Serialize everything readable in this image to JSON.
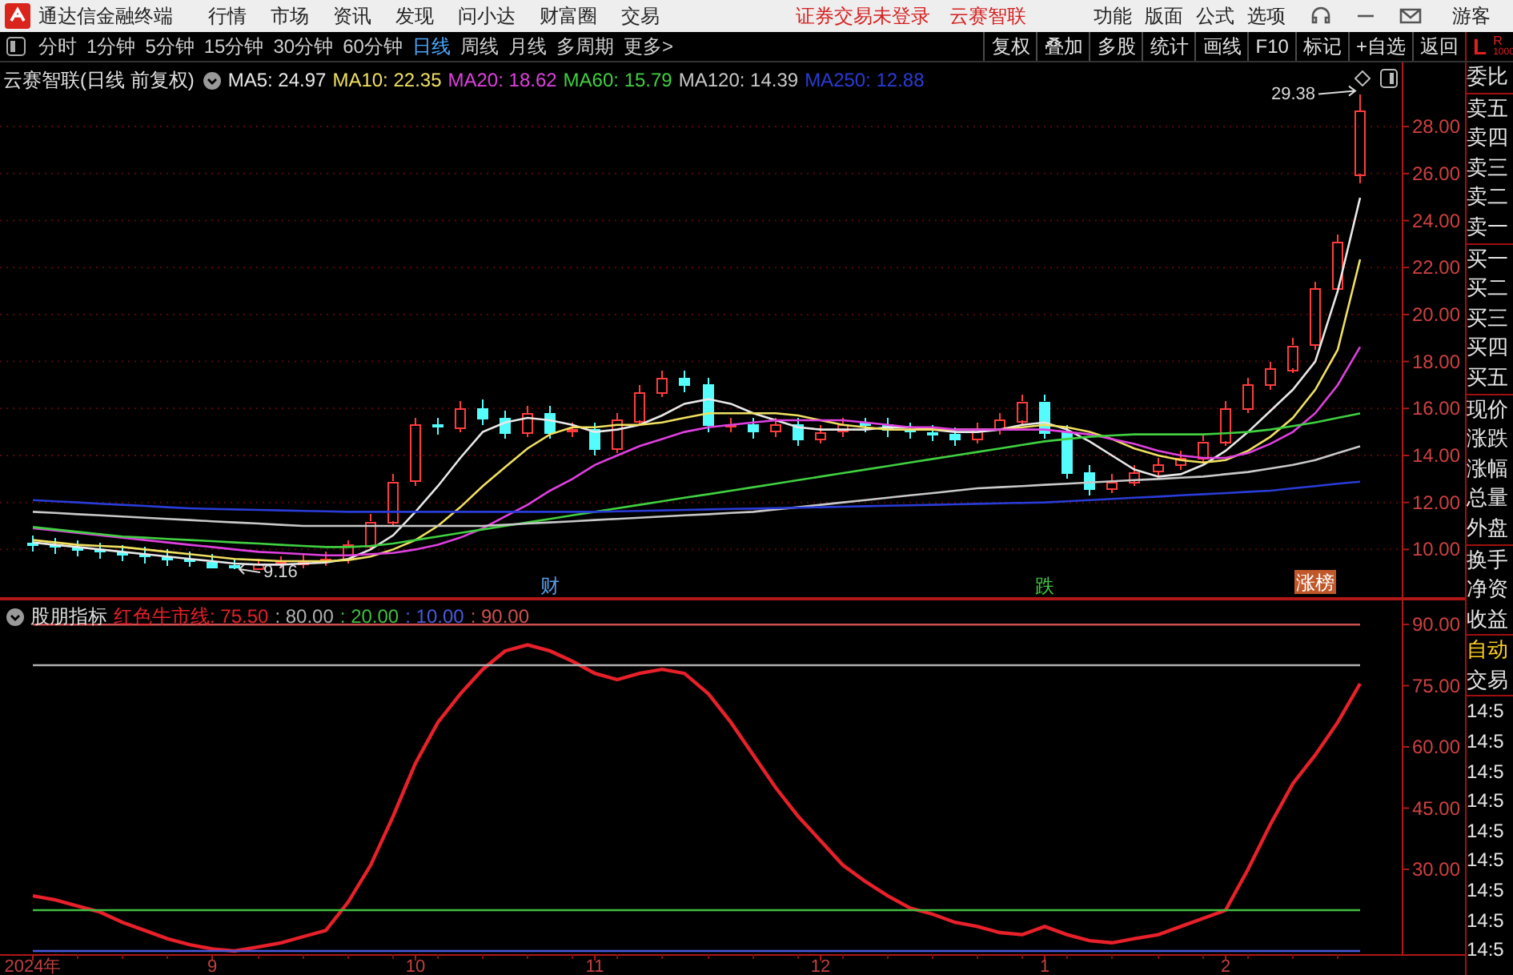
{
  "title_bar": {
    "app_name": "通达信金融终端",
    "menu": [
      "行情",
      "市场",
      "资讯",
      "发现",
      "问小达",
      "财富圈",
      "交易"
    ],
    "notices": [
      "证券交易未登录",
      "云赛智联"
    ],
    "tools": [
      "功能",
      "版面",
      "公式",
      "选项"
    ],
    "user": "游客"
  },
  "period_tabs": [
    {
      "label": "分时",
      "selected": false
    },
    {
      "label": "1分钟",
      "selected": false
    },
    {
      "label": "5分钟",
      "selected": false
    },
    {
      "label": "15分钟",
      "selected": false
    },
    {
      "label": "30分钟",
      "selected": false
    },
    {
      "label": "60分钟",
      "selected": false
    },
    {
      "label": "日线",
      "selected": true
    },
    {
      "label": "周线",
      "selected": false
    },
    {
      "label": "月线",
      "selected": false
    },
    {
      "label": "多周期",
      "selected": false
    },
    {
      "label": "更多>",
      "selected": false
    }
  ],
  "toolbar_buttons": [
    "复权",
    "叠加",
    "多股",
    "统计",
    "画线",
    "F10",
    "标记",
    "+自选",
    "返回"
  ],
  "corner": {
    "left": "L",
    "right": "R",
    "sub": "1000"
  },
  "price_panel": {
    "title": "云赛智联(日线 前复权)",
    "legend_values": [
      ": 24.97",
      ": 22.35",
      ": 18.62",
      ": 15.79",
      ": 14.39",
      ": 12.88"
    ],
    "candle_styles": [
      {
        "kind": "rising",
        "color": "#ff3c3c"
      },
      {
        "kind": "falling",
        "color": "#54fcfc"
      }
    ],
    "event_styles": [
      {
        "kind": "text",
        "color": "#5a9ee8"
      },
      {
        "kind": "text",
        "color": "#40c840"
      },
      {
        "kind": "tag",
        "color": "#c0582a"
      }
    ],
    "chart_data": {
      "type": "candlestick",
      "grid": true,
      "ylim": [
        7.9,
        30.73
      ],
      "categories": [
        null,
        null,
        null,
        null,
        null,
        null,
        null,
        null,
        null,
        null,
        null,
        null,
        null,
        null,
        null,
        null,
        null,
        null,
        null,
        null,
        null,
        null,
        null,
        "财",
        null,
        null,
        null,
        null,
        null,
        null,
        null,
        null,
        null,
        null,
        null,
        null,
        null,
        null,
        null,
        null,
        null,
        null,
        null,
        null,
        null,
        "跌",
        null,
        null,
        null,
        null,
        null,
        null,
        null,
        null,
        null,
        null,
        null,
        "涨榜",
        null,
        null
      ],
      "yticks": [
        {
          "value": 10,
          "label": "10.00"
        },
        {
          "value": 12,
          "label": "12.00"
        },
        {
          "value": 14,
          "label": "14.00"
        },
        {
          "value": 16,
          "label": "16.00"
        },
        {
          "value": 18,
          "label": "18.00"
        },
        {
          "value": 20,
          "label": "20.00"
        },
        {
          "value": 22,
          "label": "22.00"
        },
        {
          "value": 24,
          "label": "24.00"
        },
        {
          "value": 26,
          "label": "26.00"
        },
        {
          "value": 28,
          "label": "28.00"
        }
      ],
      "ohlc": [
        [
          10.3,
          10.6,
          9.9,
          10.2
        ],
        [
          10.2,
          10.5,
          9.8,
          10.1
        ],
        [
          10.1,
          10.4,
          9.7,
          10.0
        ],
        [
          10.0,
          10.3,
          9.6,
          9.9
        ],
        [
          9.9,
          10.2,
          9.5,
          9.8
        ],
        [
          9.8,
          10.1,
          9.4,
          9.7
        ],
        [
          9.7,
          10.0,
          9.3,
          9.6
        ],
        [
          9.6,
          9.9,
          9.25,
          9.5
        ],
        [
          9.5,
          9.8,
          9.2,
          9.3
        ],
        [
          9.3,
          9.6,
          9.16,
          9.2
        ],
        [
          9.2,
          9.6,
          9.17,
          9.4
        ],
        [
          9.4,
          9.7,
          9.2,
          9.45
        ],
        [
          9.45,
          9.8,
          9.2,
          9.5
        ],
        [
          9.5,
          9.9,
          9.3,
          9.6
        ],
        [
          9.6,
          10.4,
          9.4,
          10.2
        ],
        [
          10.2,
          11.5,
          10.0,
          11.2
        ],
        [
          11.2,
          13.2,
          11.0,
          12.9
        ],
        [
          12.9,
          15.6,
          12.7,
          15.3
        ],
        [
          15.3,
          15.6,
          14.9,
          15.2
        ],
        [
          15.2,
          16.3,
          15.0,
          16.0
        ],
        [
          16.0,
          16.4,
          15.3,
          15.6
        ],
        [
          15.6,
          15.9,
          14.7,
          15.0
        ],
        [
          15.0,
          16.1,
          14.8,
          15.8
        ],
        [
          15.8,
          16.1,
          14.7,
          15.0
        ],
        [
          15.0,
          15.4,
          14.8,
          15.1
        ],
        [
          15.1,
          15.4,
          14.0,
          14.3
        ],
        [
          14.3,
          15.8,
          14.1,
          15.5
        ],
        [
          15.5,
          17.0,
          15.3,
          16.7
        ],
        [
          16.7,
          17.6,
          16.5,
          17.3
        ],
        [
          17.3,
          17.6,
          16.7,
          17.0
        ],
        [
          17.0,
          17.3,
          15.0,
          15.3
        ],
        [
          15.2,
          15.6,
          15.0,
          15.3
        ],
        [
          15.3,
          15.6,
          14.7,
          15.0
        ],
        [
          15.0,
          15.6,
          14.8,
          15.3
        ],
        [
          15.3,
          15.6,
          14.4,
          14.7
        ],
        [
          14.7,
          15.3,
          14.5,
          15.0
        ],
        [
          15.0,
          15.6,
          14.8,
          15.3
        ],
        [
          15.4,
          15.6,
          15.0,
          15.3
        ],
        [
          15.3,
          15.6,
          14.8,
          15.1
        ],
        [
          15.1,
          15.4,
          14.7,
          15.0
        ],
        [
          15.0,
          15.3,
          14.6,
          14.9
        ],
        [
          14.9,
          15.2,
          14.4,
          14.7
        ],
        [
          14.7,
          15.4,
          14.5,
          15.1
        ],
        [
          15.1,
          15.8,
          14.9,
          15.5
        ],
        [
          15.5,
          16.6,
          15.3,
          16.3
        ],
        [
          16.3,
          16.6,
          14.7,
          15.0
        ],
        [
          15.0,
          15.3,
          13.0,
          13.3
        ],
        [
          13.3,
          13.6,
          12.3,
          12.6
        ],
        [
          12.6,
          13.2,
          12.4,
          12.9
        ],
        [
          12.9,
          13.6,
          12.7,
          13.3
        ],
        [
          13.3,
          13.9,
          13.1,
          13.6
        ],
        [
          13.6,
          14.2,
          13.4,
          13.9
        ],
        [
          13.9,
          14.9,
          13.7,
          14.6
        ],
        [
          14.6,
          16.3,
          14.4,
          16.0
        ],
        [
          16.0,
          17.3,
          15.8,
          17.0
        ],
        [
          17.0,
          18.0,
          16.8,
          17.7
        ],
        [
          17.7,
          19.0,
          17.5,
          18.7
        ],
        [
          18.7,
          21.4,
          18.5,
          21.1
        ],
        [
          21.1,
          23.4,
          20.9,
          23.1
        ],
        [
          26.0,
          29.38,
          25.6,
          28.7
        ]
      ],
      "series": [
        {
          "name": "MA5",
          "type": "line",
          "color": "#e8e8e8",
          "values": [
            10.3,
            10.2,
            10.1,
            10.0,
            9.9,
            9.8,
            9.7,
            9.6,
            9.5,
            9.4,
            9.35,
            9.35,
            9.4,
            9.45,
            9.6,
            10.0,
            10.6,
            11.6,
            12.7,
            13.9,
            15.0,
            15.4,
            15.6,
            15.5,
            15.3,
            15.0,
            15.1,
            15.3,
            15.7,
            16.2,
            16.4,
            16.2,
            15.8,
            15.5,
            15.2,
            15.1,
            15.1,
            15.1,
            15.2,
            15.2,
            15.1,
            15.0,
            15.0,
            15.1,
            15.3,
            15.4,
            15.1,
            14.6,
            14.0,
            13.4,
            13.1,
            13.2,
            13.6,
            14.2,
            15.0,
            15.9,
            16.8,
            18.0,
            21.0,
            24.97
          ]
        },
        {
          "name": "MA10",
          "type": "line",
          "color": "#f0e060",
          "values": [
            10.4,
            10.3,
            10.2,
            10.15,
            10.1,
            10.0,
            9.9,
            9.8,
            9.7,
            9.6,
            9.55,
            9.5,
            9.5,
            9.5,
            9.55,
            9.7,
            10.0,
            10.4,
            11.0,
            11.8,
            12.7,
            13.5,
            14.3,
            14.9,
            15.2,
            15.2,
            15.3,
            15.3,
            15.4,
            15.6,
            15.8,
            15.8,
            15.8,
            15.8,
            15.7,
            15.5,
            15.3,
            15.2,
            15.1,
            15.1,
            15.1,
            15.1,
            15.1,
            15.1,
            15.2,
            15.3,
            15.2,
            15.0,
            14.7,
            14.3,
            14.0,
            13.8,
            13.7,
            13.8,
            14.2,
            14.8,
            15.6,
            16.8,
            18.5,
            22.35
          ]
        },
        {
          "name": "MA20",
          "type": "line",
          "color": "#e040e0",
          "values": [
            10.9,
            10.8,
            10.7,
            10.6,
            10.5,
            10.4,
            10.3,
            10.2,
            10.1,
            10.0,
            9.9,
            9.85,
            9.8,
            9.75,
            9.75,
            9.8,
            9.85,
            10.0,
            10.2,
            10.5,
            10.9,
            11.4,
            11.9,
            12.5,
            13.0,
            13.6,
            14.0,
            14.4,
            14.7,
            15.0,
            15.2,
            15.3,
            15.4,
            15.5,
            15.5,
            15.5,
            15.5,
            15.4,
            15.3,
            15.2,
            15.2,
            15.1,
            15.1,
            15.1,
            15.1,
            15.1,
            15.0,
            14.9,
            14.7,
            14.5,
            14.2,
            14.0,
            13.9,
            13.9,
            14.1,
            14.5,
            15.0,
            15.8,
            17.0,
            18.62
          ]
        },
        {
          "name": "MA60",
          "type": "line",
          "color": "#40d040",
          "values": [
            10.95,
            10.85,
            10.75,
            10.65,
            10.55,
            10.5,
            10.45,
            10.4,
            10.35,
            10.3,
            10.25,
            10.2,
            10.15,
            10.1,
            10.1,
            10.15,
            10.25,
            10.4,
            10.55,
            10.7,
            10.85,
            11.0,
            11.15,
            11.3,
            11.45,
            11.6,
            11.75,
            11.9,
            12.05,
            12.2,
            12.35,
            12.5,
            12.65,
            12.8,
            12.95,
            13.1,
            13.25,
            13.4,
            13.55,
            13.7,
            13.85,
            14.0,
            14.15,
            14.3,
            14.45,
            14.6,
            14.7,
            14.8,
            14.85,
            14.9,
            14.9,
            14.9,
            14.9,
            14.95,
            15.0,
            15.1,
            15.25,
            15.4,
            15.6,
            15.79
          ]
        },
        {
          "name": "MA120",
          "type": "line",
          "color": "#c8c8c8",
          "values": [
            11.6,
            11.55,
            11.5,
            11.45,
            11.4,
            11.35,
            11.3,
            11.25,
            11.2,
            11.15,
            11.1,
            11.05,
            11.0,
            11.0,
            11.0,
            11.0,
            11.0,
            11.0,
            11.0,
            11.0,
            11.0,
            11.05,
            11.1,
            11.15,
            11.2,
            11.25,
            11.3,
            11.35,
            11.4,
            11.45,
            11.5,
            11.55,
            11.6,
            11.7,
            11.8,
            11.9,
            12.0,
            12.1,
            12.2,
            12.3,
            12.4,
            12.5,
            12.6,
            12.65,
            12.7,
            12.75,
            12.8,
            12.85,
            12.9,
            12.95,
            13.0,
            13.05,
            13.1,
            13.2,
            13.3,
            13.45,
            13.6,
            13.8,
            14.1,
            14.39
          ]
        },
        {
          "name": "MA250",
          "type": "line",
          "color": "#2a3cd8",
          "values": [
            12.1,
            12.05,
            12.0,
            11.95,
            11.9,
            11.85,
            11.8,
            11.75,
            11.72,
            11.7,
            11.68,
            11.66,
            11.64,
            11.62,
            11.6,
            11.6,
            11.6,
            11.6,
            11.6,
            11.6,
            11.6,
            11.6,
            11.6,
            11.6,
            11.6,
            11.6,
            11.62,
            11.64,
            11.66,
            11.68,
            11.7,
            11.72,
            11.74,
            11.76,
            11.78,
            11.8,
            11.82,
            11.84,
            11.86,
            11.88,
            11.9,
            11.92,
            11.94,
            11.96,
            11.98,
            12.0,
            12.05,
            12.1,
            12.15,
            12.2,
            12.25,
            12.3,
            12.35,
            12.4,
            12.45,
            12.5,
            12.6,
            12.7,
            12.8,
            12.88
          ]
        }
      ],
      "annotations": [
        "29.38",
        "9.16"
      ]
    }
  },
  "indicator_panel": {
    "title": "股朋指标",
    "legend_values": [
      ": 75.50",
      ": 80.00",
      ": 20.00",
      ": 10.00",
      ": 90.00"
    ],
    "chart_data": {
      "type": "line",
      "ylim": [
        9.2,
        96.3
      ],
      "categories": [
        "2024年",
        null,
        null,
        null,
        null,
        null,
        null,
        null,
        "9",
        null,
        null,
        null,
        null,
        null,
        null,
        null,
        null,
        "10",
        null,
        null,
        null,
        null,
        null,
        null,
        null,
        "11",
        null,
        null,
        null,
        null,
        null,
        null,
        null,
        null,
        null,
        "12",
        null,
        null,
        null,
        null,
        null,
        null,
        null,
        null,
        null,
        "1",
        null,
        null,
        null,
        null,
        null,
        null,
        null,
        "2",
        null,
        null,
        null,
        null,
        null,
        null
      ],
      "yticks": [
        {
          "value": 30,
          "label": "30.00"
        },
        {
          "value": 45,
          "label": "45.00"
        },
        {
          "value": 60,
          "label": "60.00"
        },
        {
          "value": 75,
          "label": "75.00"
        },
        {
          "value": 90,
          "label": "90.00"
        }
      ],
      "series": [
        {
          "name": "红色牛市线",
          "color": "#e8202a",
          "values": [
            23.5,
            22.5,
            21,
            19.5,
            17,
            15,
            13,
            11.5,
            10.5,
            10,
            11,
            12,
            13.5,
            15,
            22,
            31,
            43,
            56,
            66,
            73,
            79,
            83.5,
            85,
            83.5,
            81,
            78,
            76.5,
            78,
            79,
            78,
            73,
            66,
            58,
            50,
            43,
            37,
            31,
            27,
            23.5,
            20.5,
            19,
            17,
            16,
            14.5,
            14,
            16,
            14,
            12.5,
            12,
            13,
            14,
            16,
            18,
            20,
            30,
            41,
            51,
            58,
            66,
            75.5
          ]
        },
        {
          "color": "#b0b0b0",
          "values": [
            80,
            80,
            80,
            80,
            80,
            80,
            80,
            80,
            80,
            80,
            80,
            80,
            80,
            80,
            80,
            80,
            80,
            80,
            80,
            80,
            80,
            80,
            80,
            80,
            80,
            80,
            80,
            80,
            80,
            80,
            80,
            80,
            80,
            80,
            80,
            80,
            80,
            80,
            80,
            80,
            80,
            80,
            80,
            80,
            80,
            80,
            80,
            80,
            80,
            80,
            80,
            80,
            80,
            80,
            80,
            80,
            80,
            80,
            80,
            80
          ]
        },
        {
          "color": "#40c040",
          "values": [
            20,
            20,
            20,
            20,
            20,
            20,
            20,
            20,
            20,
            20,
            20,
            20,
            20,
            20,
            20,
            20,
            20,
            20,
            20,
            20,
            20,
            20,
            20,
            20,
            20,
            20,
            20,
            20,
            20,
            20,
            20,
            20,
            20,
            20,
            20,
            20,
            20,
            20,
            20,
            20,
            20,
            20,
            20,
            20,
            20,
            20,
            20,
            20,
            20,
            20,
            20,
            20,
            20,
            20,
            20,
            20,
            20,
            20,
            20,
            20
          ]
        },
        {
          "color": "#4a5ae0",
          "values": [
            10,
            10,
            10,
            10,
            10,
            10,
            10,
            10,
            10,
            10,
            10,
            10,
            10,
            10,
            10,
            10,
            10,
            10,
            10,
            10,
            10,
            10,
            10,
            10,
            10,
            10,
            10,
            10,
            10,
            10,
            10,
            10,
            10,
            10,
            10,
            10,
            10,
            10,
            10,
            10,
            10,
            10,
            10,
            10,
            10,
            10,
            10,
            10,
            10,
            10,
            10,
            10,
            10,
            10,
            10,
            10,
            10,
            10,
            10,
            10
          ]
        },
        {
          "color": "#d05050",
          "values": [
            90,
            90,
            90,
            90,
            90,
            90,
            90,
            90,
            90,
            90,
            90,
            90,
            90,
            90,
            90,
            90,
            90,
            90,
            90,
            90,
            90,
            90,
            90,
            90,
            90,
            90,
            90,
            90,
            90,
            90,
            90,
            90,
            90,
            90,
            90,
            90,
            90,
            90,
            90,
            90,
            90,
            90,
            90,
            90,
            90,
            90,
            90,
            90,
            90,
            90,
            90,
            90,
            90,
            90,
            90,
            90,
            90,
            90,
            90,
            90
          ]
        }
      ]
    }
  },
  "quote_panel": {
    "groups": [
      [
        "委比"
      ],
      [
        "卖五",
        "卖四",
        "卖三",
        "卖二",
        "卖一"
      ],
      [
        "买一",
        "买二",
        "买三",
        "买四",
        "买五"
      ],
      [
        "现价",
        "涨跌",
        "涨幅",
        "总量",
        "外盘"
      ],
      [
        "换手",
        "净资",
        "收益"
      ]
    ],
    "trade_buttons": [
      {
        "label": "自动",
        "active": true
      },
      {
        "label": "交易",
        "active": false
      }
    ],
    "ticks": [
      "14:5",
      "14:5",
      "14:5",
      "14:5",
      "14:5",
      "14:5",
      "14:5",
      "14:5",
      "14:5"
    ]
  }
}
